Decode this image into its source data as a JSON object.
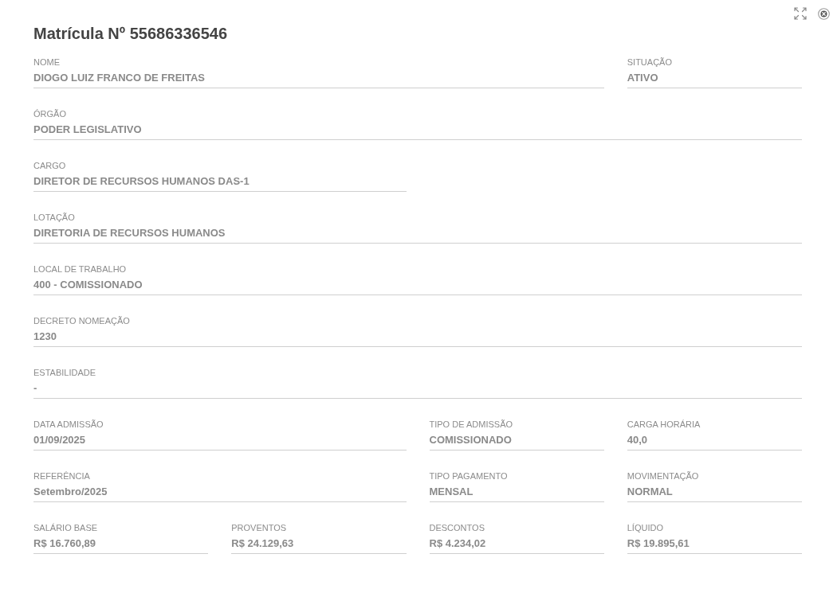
{
  "dialog": {
    "title": "Matrícula Nº 55686336546"
  },
  "rows": [
    {
      "kind": "wide",
      "fields": [
        {
          "label": "NOME",
          "value": "DIOGO LUIZ FRANCO DE FREITAS"
        },
        {
          "label": "SITUAÇÃO",
          "value": "ATIVO"
        }
      ]
    },
    {
      "kind": "wide",
      "fields": [
        {
          "label": "ÓRGÃO",
          "value": "PODER LEGISLATIVO"
        }
      ]
    },
    {
      "kind": "half",
      "fields": [
        {
          "label": "CARGO",
          "value": "DIRETOR DE RECURSOS HUMANOS DAS-1"
        }
      ]
    },
    {
      "kind": "wide",
      "fields": [
        {
          "label": "LOTAÇÃO",
          "value": "DIRETORIA DE RECURSOS HUMANOS"
        }
      ]
    },
    {
      "kind": "wide",
      "fields": [
        {
          "label": "LOCAL DE TRABALHO",
          "value": "400 - COMISSIONADO"
        }
      ]
    },
    {
      "kind": "wide",
      "fields": [
        {
          "label": "DECRETO NOMEAÇÃO",
          "value": "1230"
        }
      ]
    },
    {
      "kind": "wide",
      "fields": [
        {
          "label": "ESTABILIDADE",
          "value": "-"
        }
      ]
    },
    {
      "kind": "wide",
      "fields": [
        {
          "label": "DATA ADMISSÃO",
          "value": "01/09/2025"
        },
        {
          "label": "TIPO DE ADMISSÃO",
          "value": "COMISSIONADO"
        },
        {
          "label": "CARGA HORÁRIA",
          "value": "40,0"
        }
      ]
    },
    {
      "kind": "wide",
      "fields": [
        {
          "label": "REFERÊNCIA",
          "value": "Setembro/2025"
        },
        {
          "label": "TIPO PAGAMENTO",
          "value": "MENSAL"
        },
        {
          "label": "MOVIMENTAÇÃO",
          "value": "NORMAL"
        }
      ]
    },
    {
      "kind": "wide",
      "fields": [
        {
          "label": "SALÁRIO BASE",
          "value": "R$ 16.760,89"
        },
        {
          "label": "PROVENTOS",
          "value": "R$ 24.129,63"
        },
        {
          "label": "DESCONTOS",
          "value": "R$ 4.234,02"
        },
        {
          "label": "LÍQUIDO",
          "value": "R$ 19.895,61"
        }
      ]
    }
  ]
}
